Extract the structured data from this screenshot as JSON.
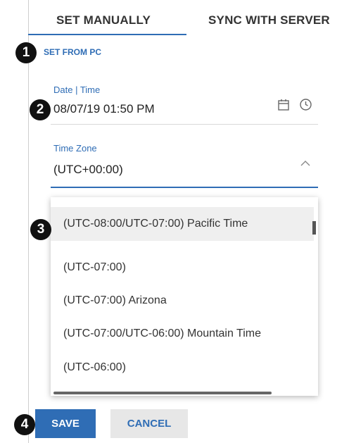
{
  "tabs": [
    {
      "label": "SET MANUALLY",
      "active": true
    },
    {
      "label": "SYNC WITH SERVER",
      "active": false
    }
  ],
  "callouts": [
    "1",
    "2",
    "3",
    "4"
  ],
  "set_from_pc": "SET FROM PC",
  "date_time": {
    "label": "Date | Time",
    "value": "08/07/19 01:50 PM",
    "icons": [
      "calendar-icon",
      "clock-icon"
    ]
  },
  "time_zone": {
    "label": "Time Zone",
    "value": "(UTC+00:00)",
    "icon": "chevron-up-icon"
  },
  "timezone_options": [
    {
      "label": "(UTC-08:00/UTC-07:00) Pacific Time",
      "highlighted": true
    },
    {
      "label": "(UTC-07:00)",
      "highlighted": false
    },
    {
      "label": "(UTC-07:00) Arizona",
      "highlighted": false
    },
    {
      "label": "(UTC-07:00/UTC-06:00) Mountain Time",
      "highlighted": false
    },
    {
      "label": "(UTC-06:00)",
      "highlighted": false
    }
  ],
  "buttons": {
    "save": "SAVE",
    "cancel": "CANCEL"
  },
  "colors": {
    "accent": "#2f6db5",
    "highlight": "#efefef",
    "button_secondary": "#e7e7e7"
  }
}
